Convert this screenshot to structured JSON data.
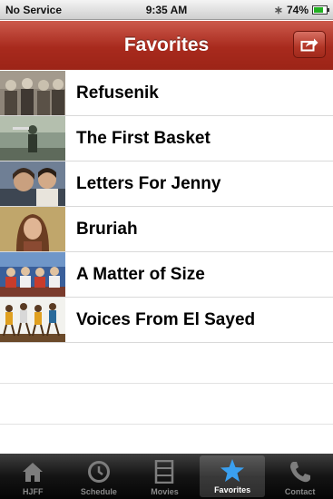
{
  "status_bar": {
    "carrier": "No Service",
    "time": "9:35 AM",
    "battery_text": "74%",
    "battery_level": 0.74
  },
  "nav": {
    "title": "Favorites",
    "share_icon": "share-icon"
  },
  "favorites": [
    {
      "title": "Refusenik",
      "thumb": "thumb-refusenik"
    },
    {
      "title": "The First Basket",
      "thumb": "thumb-first-basket"
    },
    {
      "title": "Letters For Jenny",
      "thumb": "thumb-letters-for-jenny"
    },
    {
      "title": "Bruriah",
      "thumb": "thumb-bruriah"
    },
    {
      "title": "A Matter of Size",
      "thumb": "thumb-matter-of-size"
    },
    {
      "title": "Voices From El Sayed",
      "thumb": "thumb-voices-el-sayed"
    }
  ],
  "tab_bar": {
    "tabs": [
      {
        "label": "HJFF",
        "icon": "home-icon"
      },
      {
        "label": "Schedule",
        "icon": "clock-icon"
      },
      {
        "label": "Movies",
        "icon": "film-icon"
      },
      {
        "label": "Favorites",
        "icon": "star-icon",
        "selected": true
      },
      {
        "label": "Contact",
        "icon": "phone-icon"
      }
    ]
  },
  "colors": {
    "nav_red": "#a82a1d",
    "selected_tab_star": "#3aa0f0"
  }
}
